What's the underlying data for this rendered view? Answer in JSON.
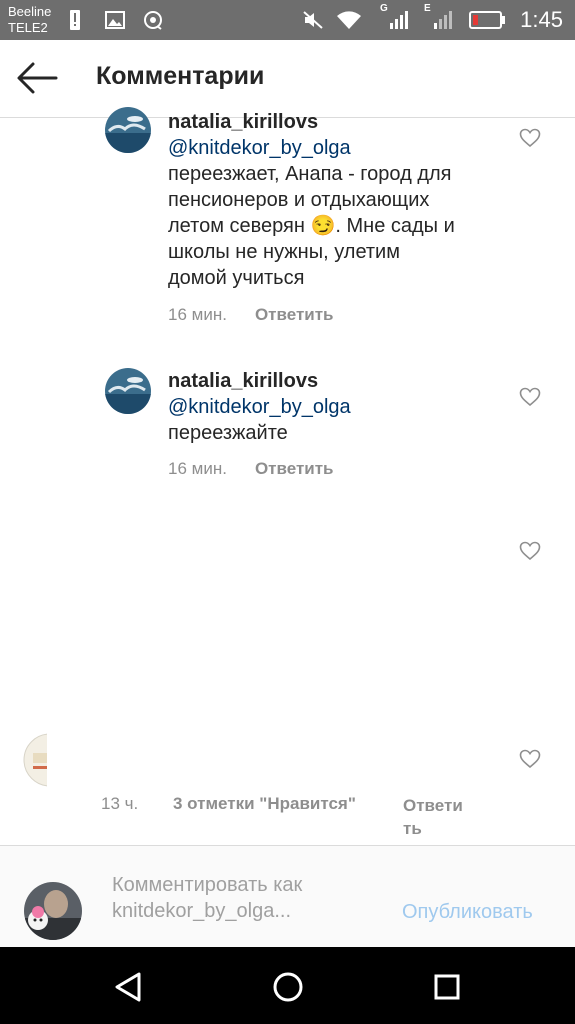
{
  "status_bar": {
    "carrier_1": "Beeline",
    "carrier_2": "TELE2",
    "network_1": "G",
    "network_2": "E",
    "time": "1:45",
    "battery_color": "#e53935"
  },
  "header": {
    "title": "Комментарии"
  },
  "comments": [
    {
      "username": "natalia_kirillovs",
      "mention": "@knitdekor_by_olga",
      "text_lines": [
        "переезжает, Анапа - город для",
        "пенсионеров и отдыхающих",
        "летом северян 😏. Мне сады и",
        "школы не нужны, улетим",
        "домой учиться"
      ],
      "time": "16 мин.",
      "reply_label": "Ответить"
    },
    {
      "username": "natalia_kirillovs",
      "mention": "@knitdekor_by_olga",
      "text": "переезжайте",
      "time": "16 мин.",
      "reply_label": "Ответить"
    }
  ],
  "parent_comment": {
    "time": "13 ч.",
    "likes": "3 отметки \"Нравится\"",
    "reply_line_1": "Ответи",
    "reply_line_2": "ть"
  },
  "composer": {
    "placeholder_line_1": "Комментировать как",
    "placeholder_line_2": "knitdekor_by_olga...",
    "publish_label": "Опубликовать"
  },
  "colors": {
    "mention": "#003569",
    "publish": "#9fc9ee",
    "meta": "#8e8e8e"
  }
}
